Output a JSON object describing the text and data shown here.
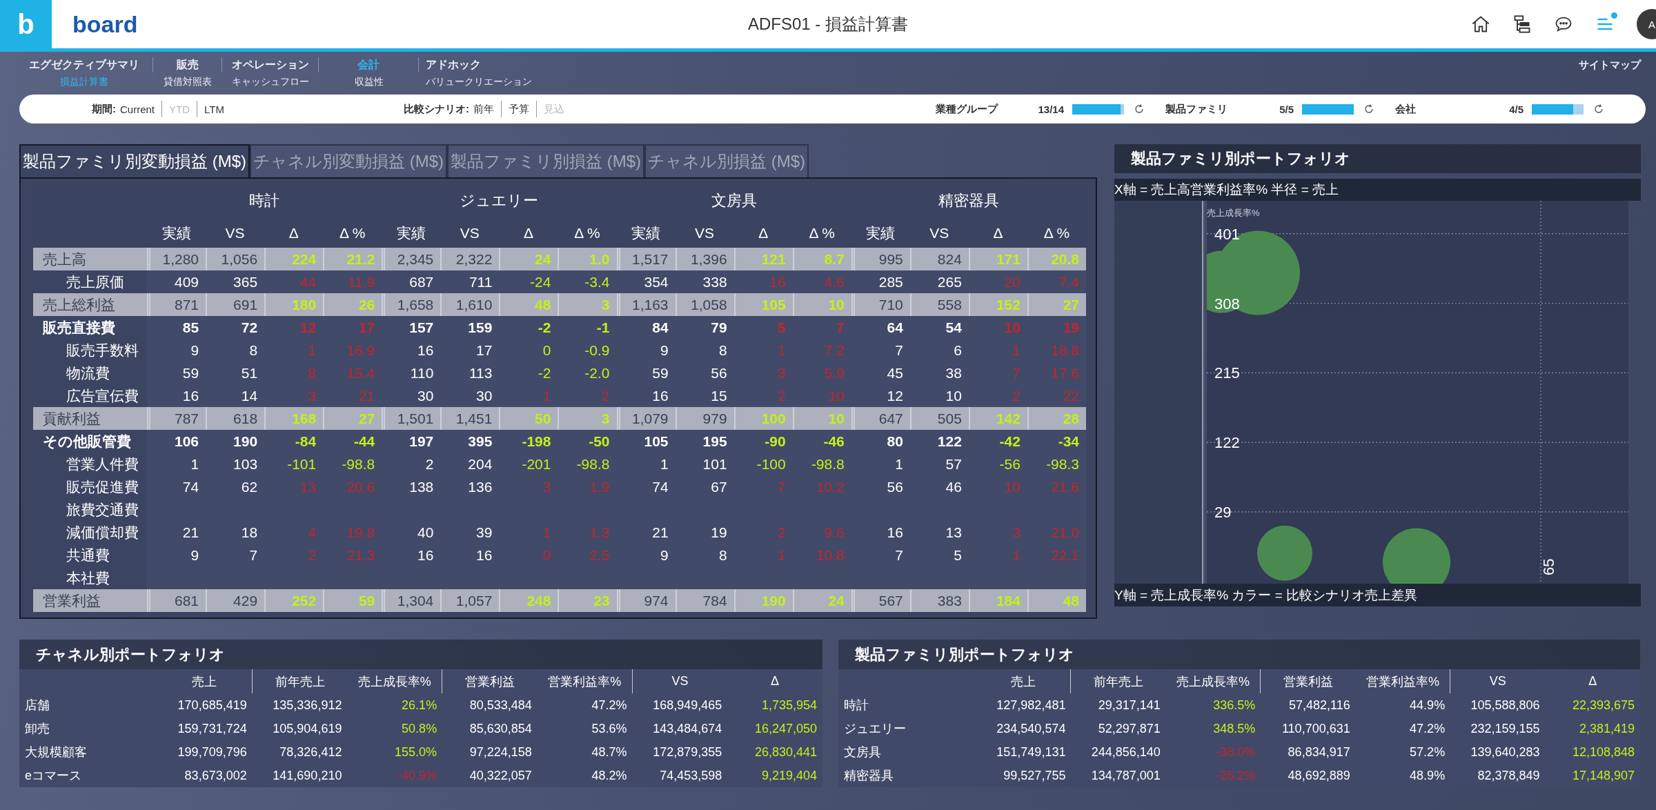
{
  "header": {
    "logo_letter": "b",
    "brand": "board",
    "title": "ADFS01 - 損益計算書",
    "notification": true,
    "avatar": "A"
  },
  "nav": {
    "items": [
      {
        "label": "エグゼクティブサマリ",
        "selected": false,
        "sub": {
          "label": "損益計算書",
          "selected": true
        }
      },
      {
        "label": "販売",
        "selected": false,
        "sub": {
          "label": "貸借対照表",
          "selected": false
        }
      },
      {
        "label": "オペレーション",
        "selected": false,
        "sub": {
          "label": "キャッシュフロー",
          "selected": false
        }
      },
      {
        "label": "会計",
        "selected": true,
        "sub": {
          "label": "収益性",
          "selected": false
        }
      },
      {
        "label": "アドホック",
        "selected": false,
        "sub": {
          "label": "バリュークリエーション",
          "selected": false
        }
      }
    ],
    "sitemap": "サイトマップ"
  },
  "filters": {
    "groups": [
      {
        "label": "期間:",
        "options": [
          {
            "label": "Current",
            "disabled": false
          },
          {
            "label": "YTD",
            "disabled": true
          },
          {
            "label": "LTM",
            "disabled": false
          }
        ]
      },
      {
        "label": "比較シナリオ:",
        "options": [
          {
            "label": "前年",
            "disabled": false
          },
          {
            "label": "予算",
            "disabled": false
          },
          {
            "label": "見込",
            "disabled": true
          }
        ]
      }
    ],
    "selectors": [
      {
        "label": "業種グループ",
        "count": "13/14",
        "level": 0.93
      },
      {
        "label": "製品ファミリ",
        "count": "5/5",
        "level": 1
      },
      {
        "label": "会社",
        "count": "4/5",
        "level": 0.8
      }
    ]
  },
  "pl_table": {
    "tabs": [
      {
        "label": "製品ファミリ別変動損益 (M$)",
        "selected": true
      },
      {
        "label": "チャネル別変動損益 (M$)",
        "selected": false
      },
      {
        "label": "製品ファミリ別損益 (M$)",
        "selected": false
      },
      {
        "label": "チャネル別損益 (M$)",
        "selected": false
      }
    ],
    "groups": [
      {
        "name": "時計",
        "columns": [
          "実績",
          "VS",
          "Δ",
          "Δ %"
        ]
      },
      {
        "name": "ジュエリー",
        "columns": [
          "実績",
          "VS",
          "Δ",
          "Δ %"
        ]
      },
      {
        "name": "文房具",
        "columns": [
          "実績",
          "VS",
          "Δ",
          "Δ %"
        ]
      },
      {
        "name": "精密器具",
        "columns": [
          "実績",
          "VS",
          "Δ",
          "Δ %"
        ]
      }
    ],
    "rows": [
      {
        "label": "売上高",
        "kind": "total",
        "cells": [
          {
            "actual": "1,280",
            "vs": "1,056",
            "delta": "224",
            "delta_pct": "21.2",
            "favorable": true
          },
          {
            "actual": "2,345",
            "vs": "2,322",
            "delta": "24",
            "delta_pct": "1.0",
            "favorable": true
          },
          {
            "actual": "1,517",
            "vs": "1,396",
            "delta": "121",
            "delta_pct": "8.7",
            "favorable": true
          },
          {
            "actual": "995",
            "vs": "824",
            "delta": "171",
            "delta_pct": "20.8",
            "favorable": true
          }
        ],
        "children": [
          {
            "label": "売上原価",
            "cells": [
              {
                "actual": "409",
                "vs": "365",
                "delta": "44",
                "delta_pct": "11.9",
                "favorable": false
              },
              {
                "actual": "687",
                "vs": "711",
                "delta": "-24",
                "delta_pct": "-3.4",
                "favorable": true
              },
              {
                "actual": "354",
                "vs": "338",
                "delta": "16",
                "delta_pct": "4.6",
                "favorable": false
              },
              {
                "actual": "285",
                "vs": "265",
                "delta": "20",
                "delta_pct": "7.4",
                "favorable": false
              }
            ]
          }
        ]
      },
      {
        "label": "売上総利益",
        "kind": "total",
        "cells": [
          {
            "actual": "871",
            "vs": "691",
            "delta": "180",
            "delta_pct": "26",
            "favorable": true
          },
          {
            "actual": "1,658",
            "vs": "1,610",
            "delta": "48",
            "delta_pct": "3",
            "favorable": true
          },
          {
            "actual": "1,163",
            "vs": "1,058",
            "delta": "105",
            "delta_pct": "10",
            "favorable": true
          },
          {
            "actual": "710",
            "vs": "558",
            "delta": "152",
            "delta_pct": "27",
            "favorable": true
          }
        ]
      },
      {
        "label": "販売直接費",
        "kind": "group",
        "cells": [
          {
            "actual": "85",
            "vs": "72",
            "delta": "12",
            "delta_pct": "17",
            "favorable": false
          },
          {
            "actual": "157",
            "vs": "159",
            "delta": "-2",
            "delta_pct": "-1",
            "favorable": true
          },
          {
            "actual": "84",
            "vs": "79",
            "delta": "5",
            "delta_pct": "7",
            "favorable": false
          },
          {
            "actual": "64",
            "vs": "54",
            "delta": "10",
            "delta_pct": "19",
            "favorable": false
          }
        ],
        "children": [
          {
            "label": "販売手数料",
            "cells": [
              {
                "actual": "9",
                "vs": "8",
                "delta": "1",
                "delta_pct": "16.9",
                "favorable": false
              },
              {
                "actual": "16",
                "vs": "17",
                "delta": "0",
                "delta_pct": "-0.9",
                "favorable": true
              },
              {
                "actual": "9",
                "vs": "8",
                "delta": "1",
                "delta_pct": "7.2",
                "favorable": false
              },
              {
                "actual": "7",
                "vs": "6",
                "delta": "1",
                "delta_pct": "18.8",
                "favorable": false
              }
            ]
          },
          {
            "label": "物流費",
            "cells": [
              {
                "actual": "59",
                "vs": "51",
                "delta": "8",
                "delta_pct": "15.4",
                "favorable": false
              },
              {
                "actual": "110",
                "vs": "113",
                "delta": "-2",
                "delta_pct": "-2.0",
                "favorable": true
              },
              {
                "actual": "59",
                "vs": "56",
                "delta": "3",
                "delta_pct": "5.9",
                "favorable": false
              },
              {
                "actual": "45",
                "vs": "38",
                "delta": "7",
                "delta_pct": "17.6",
                "favorable": false
              }
            ]
          },
          {
            "label": "広告宣伝費",
            "cells": [
              {
                "actual": "16",
                "vs": "14",
                "delta": "3",
                "delta_pct": "21",
                "favorable": false
              },
              {
                "actual": "30",
                "vs": "30",
                "delta": "1",
                "delta_pct": "2",
                "favorable": false
              },
              {
                "actual": "16",
                "vs": "15",
                "delta": "2",
                "delta_pct": "10",
                "favorable": false
              },
              {
                "actual": "12",
                "vs": "10",
                "delta": "2",
                "delta_pct": "22",
                "favorable": false
              }
            ]
          }
        ]
      },
      {
        "label": "貢献利益",
        "kind": "total",
        "cells": [
          {
            "actual": "787",
            "vs": "618",
            "delta": "168",
            "delta_pct": "27",
            "favorable": true
          },
          {
            "actual": "1,501",
            "vs": "1,451",
            "delta": "50",
            "delta_pct": "3",
            "favorable": true
          },
          {
            "actual": "1,079",
            "vs": "979",
            "delta": "100",
            "delta_pct": "10",
            "favorable": true
          },
          {
            "actual": "647",
            "vs": "505",
            "delta": "142",
            "delta_pct": "28",
            "favorable": true
          }
        ]
      },
      {
        "label": "その他販管費",
        "kind": "group",
        "cells": [
          {
            "actual": "106",
            "vs": "190",
            "delta": "-84",
            "delta_pct": "-44",
            "favorable": true
          },
          {
            "actual": "197",
            "vs": "395",
            "delta": "-198",
            "delta_pct": "-50",
            "favorable": true
          },
          {
            "actual": "105",
            "vs": "195",
            "delta": "-90",
            "delta_pct": "-46",
            "favorable": true
          },
          {
            "actual": "80",
            "vs": "122",
            "delta": "-42",
            "delta_pct": "-34",
            "favorable": true
          }
        ],
        "children": [
          {
            "label": "営業人件費",
            "cells": [
              {
                "actual": "1",
                "vs": "103",
                "delta": "-101",
                "delta_pct": "-98.8",
                "favorable": true
              },
              {
                "actual": "2",
                "vs": "204",
                "delta": "-201",
                "delta_pct": "-98.8",
                "favorable": true
              },
              {
                "actual": "1",
                "vs": "101",
                "delta": "-100",
                "delta_pct": "-98.8",
                "favorable": true
              },
              {
                "actual": "1",
                "vs": "57",
                "delta": "-56",
                "delta_pct": "-98.3",
                "favorable": true
              }
            ]
          },
          {
            "label": "販売促進費",
            "cells": [
              {
                "actual": "74",
                "vs": "62",
                "delta": "13",
                "delta_pct": "20.6",
                "favorable": false
              },
              {
                "actual": "138",
                "vs": "136",
                "delta": "3",
                "delta_pct": "1.9",
                "favorable": false
              },
              {
                "actual": "74",
                "vs": "67",
                "delta": "7",
                "delta_pct": "10.2",
                "favorable": false
              },
              {
                "actual": "56",
                "vs": "46",
                "delta": "10",
                "delta_pct": "21.6",
                "favorable": false
              }
            ]
          },
          {
            "label": "旅費交通費"
          },
          {
            "label": "減価償却費",
            "cells": [
              {
                "actual": "21",
                "vs": "18",
                "delta": "4",
                "delta_pct": "19.8",
                "favorable": false
              },
              {
                "actual": "40",
                "vs": "39",
                "delta": "1",
                "delta_pct": "1.3",
                "favorable": false
              },
              {
                "actual": "21",
                "vs": "19",
                "delta": "2",
                "delta_pct": "9.6",
                "favorable": false
              },
              {
                "actual": "16",
                "vs": "13",
                "delta": "3",
                "delta_pct": "21.0",
                "favorable": false
              }
            ]
          },
          {
            "label": "共通費",
            "cells": [
              {
                "actual": "9",
                "vs": "7",
                "delta": "2",
                "delta_pct": "21.3",
                "favorable": false
              },
              {
                "actual": "16",
                "vs": "16",
                "delta": "0",
                "delta_pct": "2.5",
                "favorable": false
              },
              {
                "actual": "9",
                "vs": "8",
                "delta": "1",
                "delta_pct": "10.8",
                "favorable": false
              },
              {
                "actual": "7",
                "vs": "5",
                "delta": "1",
                "delta_pct": "22.1",
                "favorable": false
              }
            ]
          },
          {
            "label": "本社費"
          }
        ]
      },
      {
        "label": "営業利益",
        "kind": "total",
        "cells": [
          {
            "actual": "681",
            "vs": "429",
            "delta": "252",
            "delta_pct": "59",
            "favorable": true
          },
          {
            "actual": "1,304",
            "vs": "1,057",
            "delta": "248",
            "delta_pct": "23",
            "favorable": true
          },
          {
            "actual": "974",
            "vs": "784",
            "delta": "190",
            "delta_pct": "24",
            "favorable": true
          },
          {
            "actual": "567",
            "vs": "383",
            "delta": "184",
            "delta_pct": "48",
            "favorable": true
          }
        ]
      }
    ]
  },
  "portfolio_chart": {
    "title": "製品ファミリ別ポートフォリオ",
    "subtitle": "X軸 = 売上高営業利益率% 半径 = 売上",
    "footer": "Y軸 = 売上成長率% カラー = 比較シナリオ売上差異",
    "axis_title": "売上成長率%",
    "y_ticks": [
      "401",
      "308",
      "215",
      "122",
      "29"
    ],
    "x_tick": "65"
  },
  "bottom_tables": [
    {
      "title": "チャネル別ポートフォリオ",
      "columns": [
        "売上",
        "前年売上",
        "売上成長率%",
        "営業利益",
        "営業利益率%",
        "VS",
        "Δ"
      ],
      "rows": [
        {
          "label": "店舗",
          "values": [
            "170,685,419",
            "135,336,912",
            "26.1%",
            "80,533,484",
            "47.2%",
            "168,949,465",
            "1,735,954"
          ],
          "growth_favorable": true,
          "delta_favorable": true
        },
        {
          "label": "卸売",
          "values": [
            "159,731,724",
            "105,904,619",
            "50.8%",
            "85,630,854",
            "53.6%",
            "143,484,674",
            "16,247,050"
          ],
          "growth_favorable": true,
          "delta_favorable": true
        },
        {
          "label": "大規模顧客",
          "values": [
            "199,709,796",
            "78,326,412",
            "155.0%",
            "97,224,158",
            "48.7%",
            "172,879,355",
            "26,830,441"
          ],
          "growth_favorable": true,
          "delta_favorable": true
        },
        {
          "label": "eコマース",
          "values": [
            "83,673,002",
            "141,690,210",
            "-40.9%",
            "40,322,057",
            "48.2%",
            "74,453,598",
            "9,219,404"
          ],
          "growth_favorable": false,
          "delta_favorable": true
        }
      ]
    },
    {
      "title": "製品ファミリ別ポートフォリオ",
      "columns": [
        "売上",
        "前年売上",
        "売上成長率%",
        "営業利益",
        "営業利益率%",
        "VS",
        "Δ"
      ],
      "rows": [
        {
          "label": "時計",
          "values": [
            "127,982,481",
            "29,317,141",
            "336.5%",
            "57,482,116",
            "44.9%",
            "105,588,806",
            "22,393,675"
          ],
          "growth_favorable": true,
          "delta_favorable": true
        },
        {
          "label": "ジュエリー",
          "values": [
            "234,540,574",
            "52,297,871",
            "348.5%",
            "110,700,631",
            "47.2%",
            "232,159,155",
            "2,381,419"
          ],
          "growth_favorable": true,
          "delta_favorable": true
        },
        {
          "label": "文房具",
          "values": [
            "151,749,131",
            "244,856,140",
            "-38.0%",
            "86,834,917",
            "57.2%",
            "139,640,283",
            "12,108,848"
          ],
          "growth_favorable": false,
          "delta_favorable": true
        },
        {
          "label": "精密器具",
          "values": [
            "99,527,755",
            "134,787,001",
            "-26.2%",
            "48,692,889",
            "48.9%",
            "82,378,849",
            "17,148,907"
          ],
          "growth_favorable": false,
          "delta_favorable": true
        }
      ]
    }
  ]
}
